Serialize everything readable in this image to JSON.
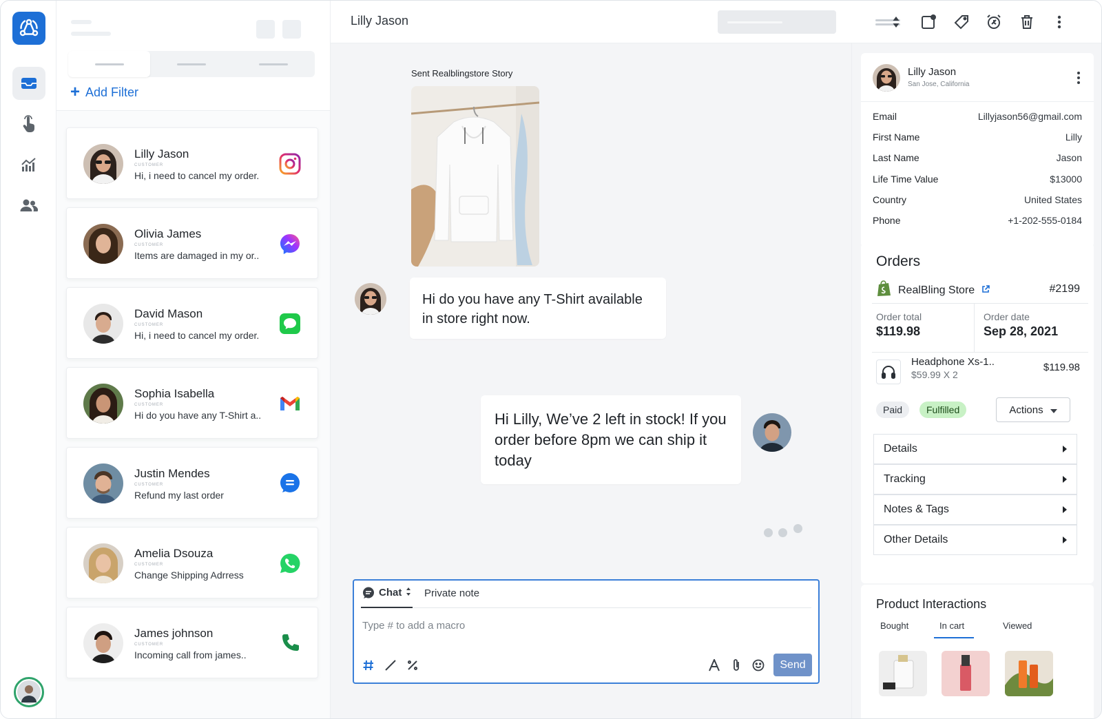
{
  "topbar": {
    "title": "Lilly Jason"
  },
  "list": {
    "add_filter": "Add Filter",
    "conversations": [
      {
        "name": "Lilly Jason",
        "tag": "CUSTOMER",
        "message": "Hi, i need to cancel my order.",
        "channel": "instagram-icon"
      },
      {
        "name": "Olivia James",
        "tag": "CUSTOMER",
        "message": "Items are damaged in my or..",
        "channel": "messenger-icon"
      },
      {
        "name": "David  Mason",
        "tag": "CUSTOMER",
        "message": "Hi, i need to cancel my order.",
        "channel": "sms-icon"
      },
      {
        "name": "Sophia Isabella",
        "tag": "CUSTOMER",
        "message": "Hi do you have any T-Shirt a..",
        "channel": "gmail-icon"
      },
      {
        "name": "Justin Mendes",
        "tag": "CUSTOMER",
        "message": "Refund my last order",
        "channel": "chat-icon"
      },
      {
        "name": "Amelia Dsouza",
        "tag": "CUSTOMER",
        "message": "Change Shipping Adrress",
        "channel": "whatsapp-icon"
      },
      {
        "name": "James johnson",
        "tag": "CUSTOMER",
        "message": "Incoming call from james..",
        "channel": "phone-icon"
      }
    ]
  },
  "chat": {
    "story_label": "Sent Realblingstore Story",
    "incoming": "Hi do you have any T-Shirt available in store right now.",
    "outgoing": "Hi Lilly, We’ve 2 left in stock! If you order before 8pm we can ship it today",
    "composer": {
      "mode_chat": "Chat",
      "mode_note": "Private note",
      "placeholder": "Type # to add a macro",
      "send": "Send"
    }
  },
  "contact": {
    "name": "Lilly Jason",
    "location": "San Jose, California",
    "fields": [
      {
        "label": "Email",
        "value": "Lillyjason56@gmail.com"
      },
      {
        "label": "First Name",
        "value": "Lilly"
      },
      {
        "label": "Last Name",
        "value": "Jason"
      },
      {
        "label": "Life Time Value",
        "value": "$13000"
      },
      {
        "label": "Country",
        "value": "United States"
      },
      {
        "label": "Phone",
        "value": "+1-202-555-0184"
      }
    ]
  },
  "orders": {
    "heading": "Orders",
    "store": "RealBling Store",
    "order_number": "#2199",
    "total_label": "Order total",
    "total_value": "$119.98",
    "date_label": "Order date",
    "date_value": "Sep 28, 2021",
    "product_name": "Headphone Xs-1..",
    "product_qty": "$59.99 X 2",
    "product_price": "$119.98",
    "badge_paid": "Paid",
    "badge_fulfilled": "Fulfilled",
    "actions": "Actions",
    "sections": [
      "Details",
      "Tracking",
      "Notes & Tags",
      "Other Details"
    ]
  },
  "product_interactions": {
    "heading": "Product Interactions",
    "tabs": [
      "Bought",
      "In cart",
      "Viewed"
    ],
    "active_tab": "In cart"
  },
  "colors": {
    "accent": "#1d6fd6",
    "send_button": "#6f92c9",
    "paid_badge": "#eceef1",
    "fulfilled_badge": "#c8f1c5"
  }
}
